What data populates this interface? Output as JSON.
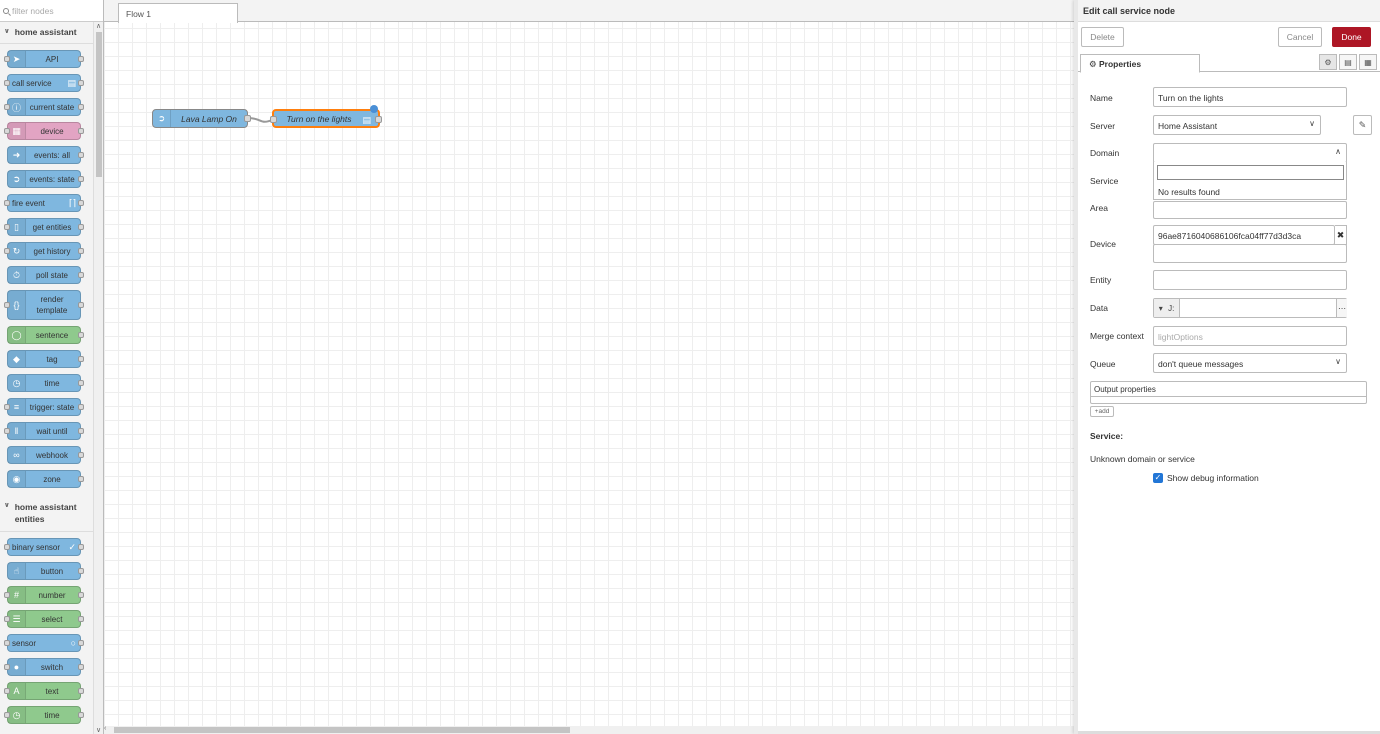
{
  "palette": {
    "filter_placeholder": "filter nodes",
    "categories": [
      {
        "name": "home assistant",
        "nodes": [
          {
            "label": "API",
            "icon": "paper-plane-icon"
          },
          {
            "label": "call service",
            "icon": "router-icon"
          },
          {
            "label": "current state",
            "icon": "info-circle-icon"
          },
          {
            "label": "device",
            "icon": "cube-icon"
          },
          {
            "label": "events: all",
            "icon": "arrow-right-icon"
          },
          {
            "label": "events: state",
            "icon": "arrow-circle-icon"
          },
          {
            "label": "fire event",
            "icon": "broadcast-tower-icon"
          },
          {
            "label": "get entities",
            "icon": "file-icon"
          },
          {
            "label": "get history",
            "icon": "history-icon"
          },
          {
            "label": "poll state",
            "icon": "timer-icon"
          },
          {
            "label": "render template",
            "icon": "braces-icon"
          },
          {
            "label": "sentence",
            "icon": "speech-bubble-icon"
          },
          {
            "label": "tag",
            "icon": "tag-icon"
          },
          {
            "label": "time",
            "icon": "clock-icon"
          },
          {
            "label": "trigger: state",
            "icon": "sliders-icon"
          },
          {
            "label": "wait until",
            "icon": "pause-circle-icon"
          },
          {
            "label": "webhook",
            "icon": "webhook-icon"
          },
          {
            "label": "zone",
            "icon": "map-marker-icon"
          }
        ]
      },
      {
        "name": "home assistant entities",
        "nodes": [
          {
            "label": "binary sensor",
            "icon": "check-circle-icon"
          },
          {
            "label": "button",
            "icon": "hand-pointer-icon"
          },
          {
            "label": "number",
            "icon": "hash-icon"
          },
          {
            "label": "select",
            "icon": "list-icon"
          },
          {
            "label": "sensor",
            "icon": "circle-icon"
          },
          {
            "label": "switch",
            "icon": "toggle-icon"
          },
          {
            "label": "text",
            "icon": "letter-a-icon"
          },
          {
            "label": "time",
            "icon": "clock-icon"
          }
        ]
      }
    ]
  },
  "workspace": {
    "tab_label": "Flow 1",
    "nodes": [
      {
        "label": "Lava Lamp On",
        "icon": "arrow-circle-icon"
      },
      {
        "label": "Turn on the lights",
        "icon": "router-icon"
      }
    ]
  },
  "tray": {
    "title": "Edit call service node",
    "delete_label": "Delete",
    "cancel_label": "Cancel",
    "done_label": "Done",
    "properties_tab": "Properties",
    "fields": {
      "name_label": "Name",
      "name_value": "Turn on the lights",
      "server_label": "Server",
      "server_value": "Home Assistant",
      "domain_label": "Domain",
      "domain_value": "",
      "domain_no_results": "No results found",
      "service_label": "Service",
      "area_label": "Area",
      "device_label": "Device",
      "device_value": "96ae8716040686106fca04ff77d3d3ca",
      "entity_label": "Entity",
      "data_label": "Data",
      "data_type": "J:",
      "merge_context_label": "Merge context",
      "merge_context_placeholder": "lightOptions",
      "queue_label": "Queue",
      "queue_value": "don't queue messages",
      "output_properties": "Output properties",
      "add_label": "add"
    },
    "service_heading": "Service:",
    "service_info": "Unknown domain or service",
    "debug_label": "Show debug information",
    "debug_checked": true
  },
  "colors": {
    "node_blue": "#7fb7df",
    "node_pink": "#e2a4c3",
    "node_green": "#8fc98d",
    "done_red": "#ad1625",
    "selected_orange": "#ff7f0e"
  }
}
